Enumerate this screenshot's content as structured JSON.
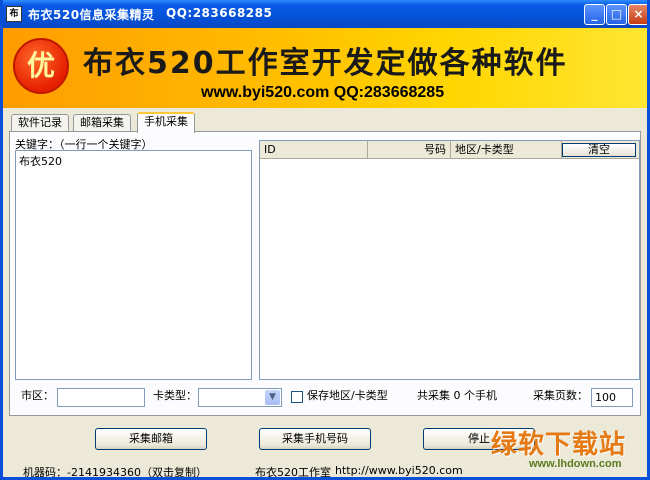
{
  "window": {
    "title": "布衣520信息采集精灵",
    "title_qq": "QQ:283668285",
    "icon": "app-icon",
    "app_icon_glyph": "布"
  },
  "banner": {
    "logo_char": "优",
    "title": "布衣520工作室开发定做各种软件",
    "url_line": "www.byi520.com QQ:283668285"
  },
  "tabs": [
    {
      "label": "软件记录"
    },
    {
      "label": "邮箱采集"
    },
    {
      "label": "手机采集",
      "active": true
    }
  ],
  "keywords": {
    "label": "关键字：（一行一个关键字）",
    "value": "布衣520"
  },
  "list": {
    "columns": [
      "ID",
      "号码",
      "地区/卡类型"
    ],
    "clear_label": "清空",
    "rows": []
  },
  "filters": {
    "city_label": "市区：",
    "city_value": "",
    "card_label": "卡类型：",
    "card_value": "",
    "save_label": "保存地区/卡类型",
    "total_text": "共采集 0 个手机",
    "pages_label": "采集页数：",
    "pages_value": "100"
  },
  "buttons": {
    "email": "采集邮箱",
    "phone": "采集手机号码",
    "stop": "停止"
  },
  "status": {
    "machine": "机器码：-2141934360（双击复制）",
    "studio": "布衣520工作室",
    "url": "http://www.byi520.com"
  },
  "watermark": {
    "big": "绿软下载站",
    "small": "www.lhdown.com"
  },
  "colors": {
    "titlebar": "#0552d8",
    "banner_start": "#ff9c00",
    "banner_end": "#ffe633",
    "watermark": "#e57a14"
  }
}
